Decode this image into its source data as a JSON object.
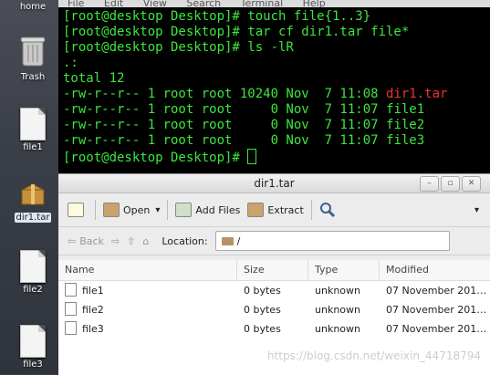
{
  "desktop": {
    "icons": [
      {
        "label": "home",
        "type": "home-folder"
      },
      {
        "label": "Trash",
        "type": "trash"
      },
      {
        "label": "file1",
        "type": "file"
      },
      {
        "label": "dir1.tar",
        "type": "archive",
        "selected": true
      },
      {
        "label": "file2",
        "type": "file"
      },
      {
        "label": "file3",
        "type": "file"
      }
    ]
  },
  "terminal": {
    "menu": [
      "File",
      "Edit",
      "View",
      "Search",
      "Terminal",
      "Help"
    ],
    "lines": [
      "[root@desktop Desktop]# touch file{1..3}",
      "[root@desktop Desktop]# tar cf dir1.tar file*",
      "[root@desktop Desktop]# ls -lR",
      ".:",
      "total 12"
    ],
    "listing": [
      {
        "perm": "-rw-r--r--",
        "links": "1",
        "user": "root",
        "group": "root",
        "size": "10240",
        "mon": "Nov",
        "day": "7",
        "time": "11:08",
        "name": "dir1.tar",
        "highlight": true
      },
      {
        "perm": "-rw-r--r--",
        "links": "1",
        "user": "root",
        "group": "root",
        "size": "0",
        "mon": "Nov",
        "day": "7",
        "time": "11:07",
        "name": "file1"
      },
      {
        "perm": "-rw-r--r--",
        "links": "1",
        "user": "root",
        "group": "root",
        "size": "0",
        "mon": "Nov",
        "day": "7",
        "time": "11:07",
        "name": "file2"
      },
      {
        "perm": "-rw-r--r--",
        "links": "1",
        "user": "root",
        "group": "root",
        "size": "0",
        "mon": "Nov",
        "day": "7",
        "time": "11:07",
        "name": "file3"
      }
    ],
    "prompt": "[root@desktop Desktop]# "
  },
  "archive_window": {
    "title": "dir1.tar",
    "toolbar": {
      "open": "Open",
      "add_files": "Add Files",
      "extract": "Extract"
    },
    "location": {
      "back": "Back",
      "label": "Location:",
      "path": "/"
    },
    "columns": [
      "Name",
      "Size",
      "Type",
      "Modified"
    ],
    "rows": [
      {
        "name": "file1",
        "size": "0 bytes",
        "type": "unknown",
        "modified": "07 November 201…"
      },
      {
        "name": "file2",
        "size": "0 bytes",
        "type": "unknown",
        "modified": "07 November 201…"
      },
      {
        "name": "file3",
        "size": "0 bytes",
        "type": "unknown",
        "modified": "07 November 201…"
      }
    ]
  },
  "watermark": "https://blog.csdn.net/weixin_44718794",
  "colors": {
    "terminal_text": "#3de63d",
    "archive_highlight": "#ee3333"
  }
}
